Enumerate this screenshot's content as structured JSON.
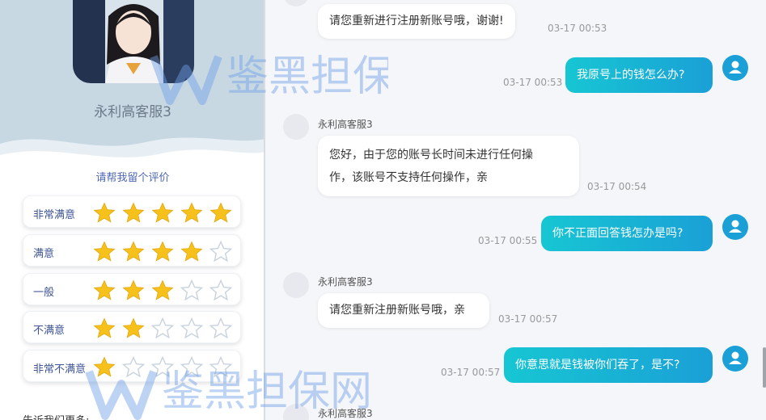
{
  "profile": {
    "agent_name": "永利高客服3",
    "rate_prompt": "请帮我留个评价",
    "tell_more": "告诉我们更多:"
  },
  "ratings": [
    {
      "label": "非常满意",
      "stars": 5
    },
    {
      "label": "满意",
      "stars": 4
    },
    {
      "label": "一般",
      "stars": 3
    },
    {
      "label": "不满意",
      "stars": 2
    },
    {
      "label": "非常不满意",
      "stars": 1
    }
  ],
  "messages": {
    "m1": {
      "text": "请您重新进行注册新账号哦，谢谢!",
      "time": "03-17 00:53"
    },
    "m2": {
      "text": "我原号上的钱怎么办?",
      "time": "03-17 00:53"
    },
    "m3": {
      "sender": "永利高客服3",
      "line1": "您好，由于您的账号长时间未进行任何操",
      "line2": "作，该账号不支持任何操作，亲",
      "time": "03-17 00:54"
    },
    "m4": {
      "text": "你不正面回答钱怎办是吗?",
      "time": "03-17 00:55"
    },
    "m5": {
      "sender": "永利高客服3",
      "text": "请您重新注册新账号哦，亲",
      "time": "03-17 00:57"
    },
    "m6": {
      "text": "你意思就是钱被你们吞了，是不?",
      "time": "03-17 00:57"
    },
    "m7": {
      "sender": "永利高客服3"
    }
  },
  "watermark": {
    "text": "鉴黑担保网"
  },
  "colors": {
    "accent": "#1aa0d6",
    "star_filled": "#f6c11a",
    "star_empty": "#c8d2dc"
  }
}
